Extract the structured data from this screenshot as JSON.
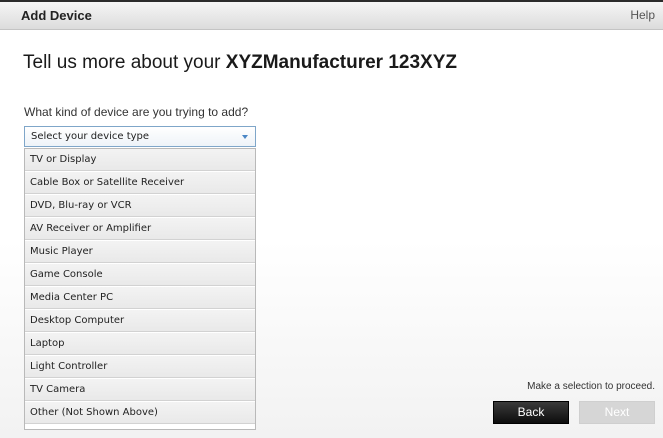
{
  "window": {
    "title": "Add Device",
    "help_label": "Help"
  },
  "main": {
    "heading_prefix": "Tell us more about your ",
    "heading_device": "XYZManufacturer 123XYZ",
    "question": "What kind of device are you trying to add?"
  },
  "device_select": {
    "selected": "Select your device type",
    "options": [
      "TV or Display",
      "Cable Box or Satellite Receiver",
      "DVD, Blu-ray or VCR",
      "AV Receiver or Amplifier",
      "Music Player",
      "Game Console",
      "Media Center PC",
      "Desktop Computer",
      "Laptop",
      "Light Controller",
      "TV Camera",
      "Other (Not Shown Above)"
    ]
  },
  "footer": {
    "hint": "Make a selection to proceed.",
    "back_label": "Back",
    "next_label": "Next",
    "next_enabled": false
  },
  "colors": {
    "accent_blue": "#4a86c5",
    "back_button": "#1a1a1a",
    "next_disabled": "#d6d6d6"
  }
}
